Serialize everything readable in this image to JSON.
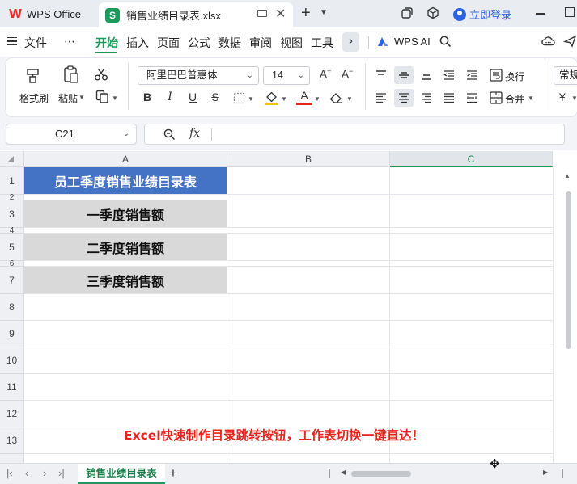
{
  "titlebar": {
    "home_tab": "WPS Office",
    "doc_tab": "销售业绩目录表.xlsx",
    "doc_icon": "S",
    "login": "立即登录"
  },
  "menu": {
    "file": "文件",
    "more": "⋯",
    "items": [
      "开始",
      "插入",
      "页面",
      "公式",
      "数据",
      "审阅",
      "视图",
      "工具"
    ],
    "ai": "WPS AI"
  },
  "ribbon": {
    "format_painter": "格式刷",
    "paste": "粘贴",
    "font_name": "阿里巴巴普惠体",
    "font_size": "14",
    "wrap": "换行",
    "merge": "合并",
    "general": "常规"
  },
  "formula_bar": {
    "name_box": "C21",
    "fx": "fx",
    "value": ""
  },
  "sheet": {
    "columns": [
      "A",
      "B",
      "C"
    ],
    "rows": [
      "1",
      "2",
      "3",
      "4",
      "5",
      "6",
      "7",
      "8",
      "9",
      "10",
      "11",
      "12",
      "13"
    ],
    "cells": {
      "A1": "员工季度销售业绩目录表",
      "A3": "一季度销售额",
      "A5": "二季度销售额",
      "A7": "三季度销售额"
    },
    "banner": "Excel快速制作目录跳转按钮，工作表切换一键直达！"
  },
  "sheet_tabs": {
    "active": "销售业绩目录表",
    "add": "+"
  },
  "colors": {
    "accent": "#1a9b5c",
    "title_fill": "#4472c4",
    "quarter_fill": "#d9d9d9",
    "banner_text": "#e8221c"
  }
}
